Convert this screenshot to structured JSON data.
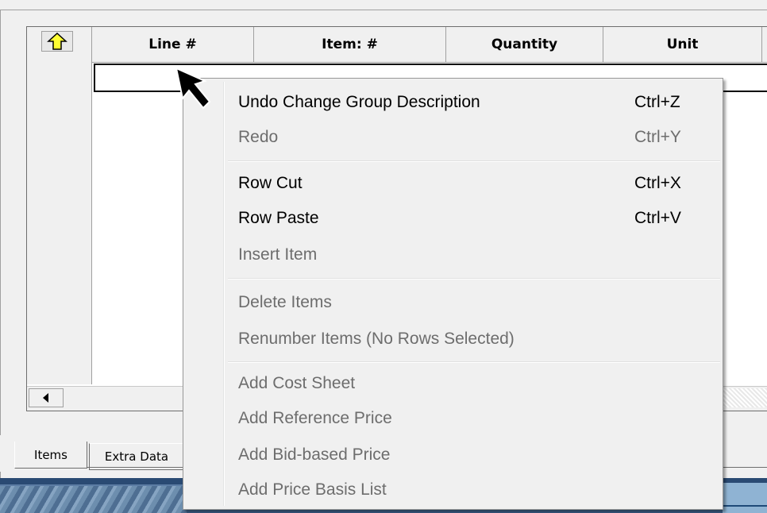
{
  "grid": {
    "sort_button": "up-arrow-icon",
    "columns": [
      "Line #",
      "Item: #",
      "Quantity",
      "Unit"
    ]
  },
  "tabs": [
    {
      "label": "Items",
      "active": true
    },
    {
      "label": "Extra Data",
      "active": false
    }
  ],
  "context_menu": {
    "items": [
      {
        "label": "Undo Change Group Description",
        "shortcut": "Ctrl+Z",
        "enabled": true
      },
      {
        "label": "Redo",
        "shortcut": "Ctrl+Y",
        "enabled": false
      },
      {
        "label": "Row Cut",
        "shortcut": "Ctrl+X",
        "enabled": true
      },
      {
        "label": "Row Paste",
        "shortcut": "Ctrl+V",
        "enabled": true
      },
      {
        "label": "Insert Item",
        "shortcut": "",
        "enabled": false
      },
      {
        "label": "Delete Items",
        "shortcut": "",
        "enabled": false
      },
      {
        "label": "Renumber Items (No Rows Selected)",
        "shortcut": "",
        "enabled": false
      },
      {
        "label": "Add Cost Sheet",
        "shortcut": "",
        "enabled": false
      },
      {
        "label": "Add Reference Price",
        "shortcut": "",
        "enabled": false
      },
      {
        "label": "Add Bid-based Price",
        "shortcut": "",
        "enabled": false
      },
      {
        "label": "Add Price Basis List",
        "shortcut": "",
        "enabled": false
      }
    ]
  },
  "colors": {
    "arrow_fill": "#ffff33",
    "disabled_text": "#6d6d6d",
    "menu_bg": "#f0f0f0"
  }
}
